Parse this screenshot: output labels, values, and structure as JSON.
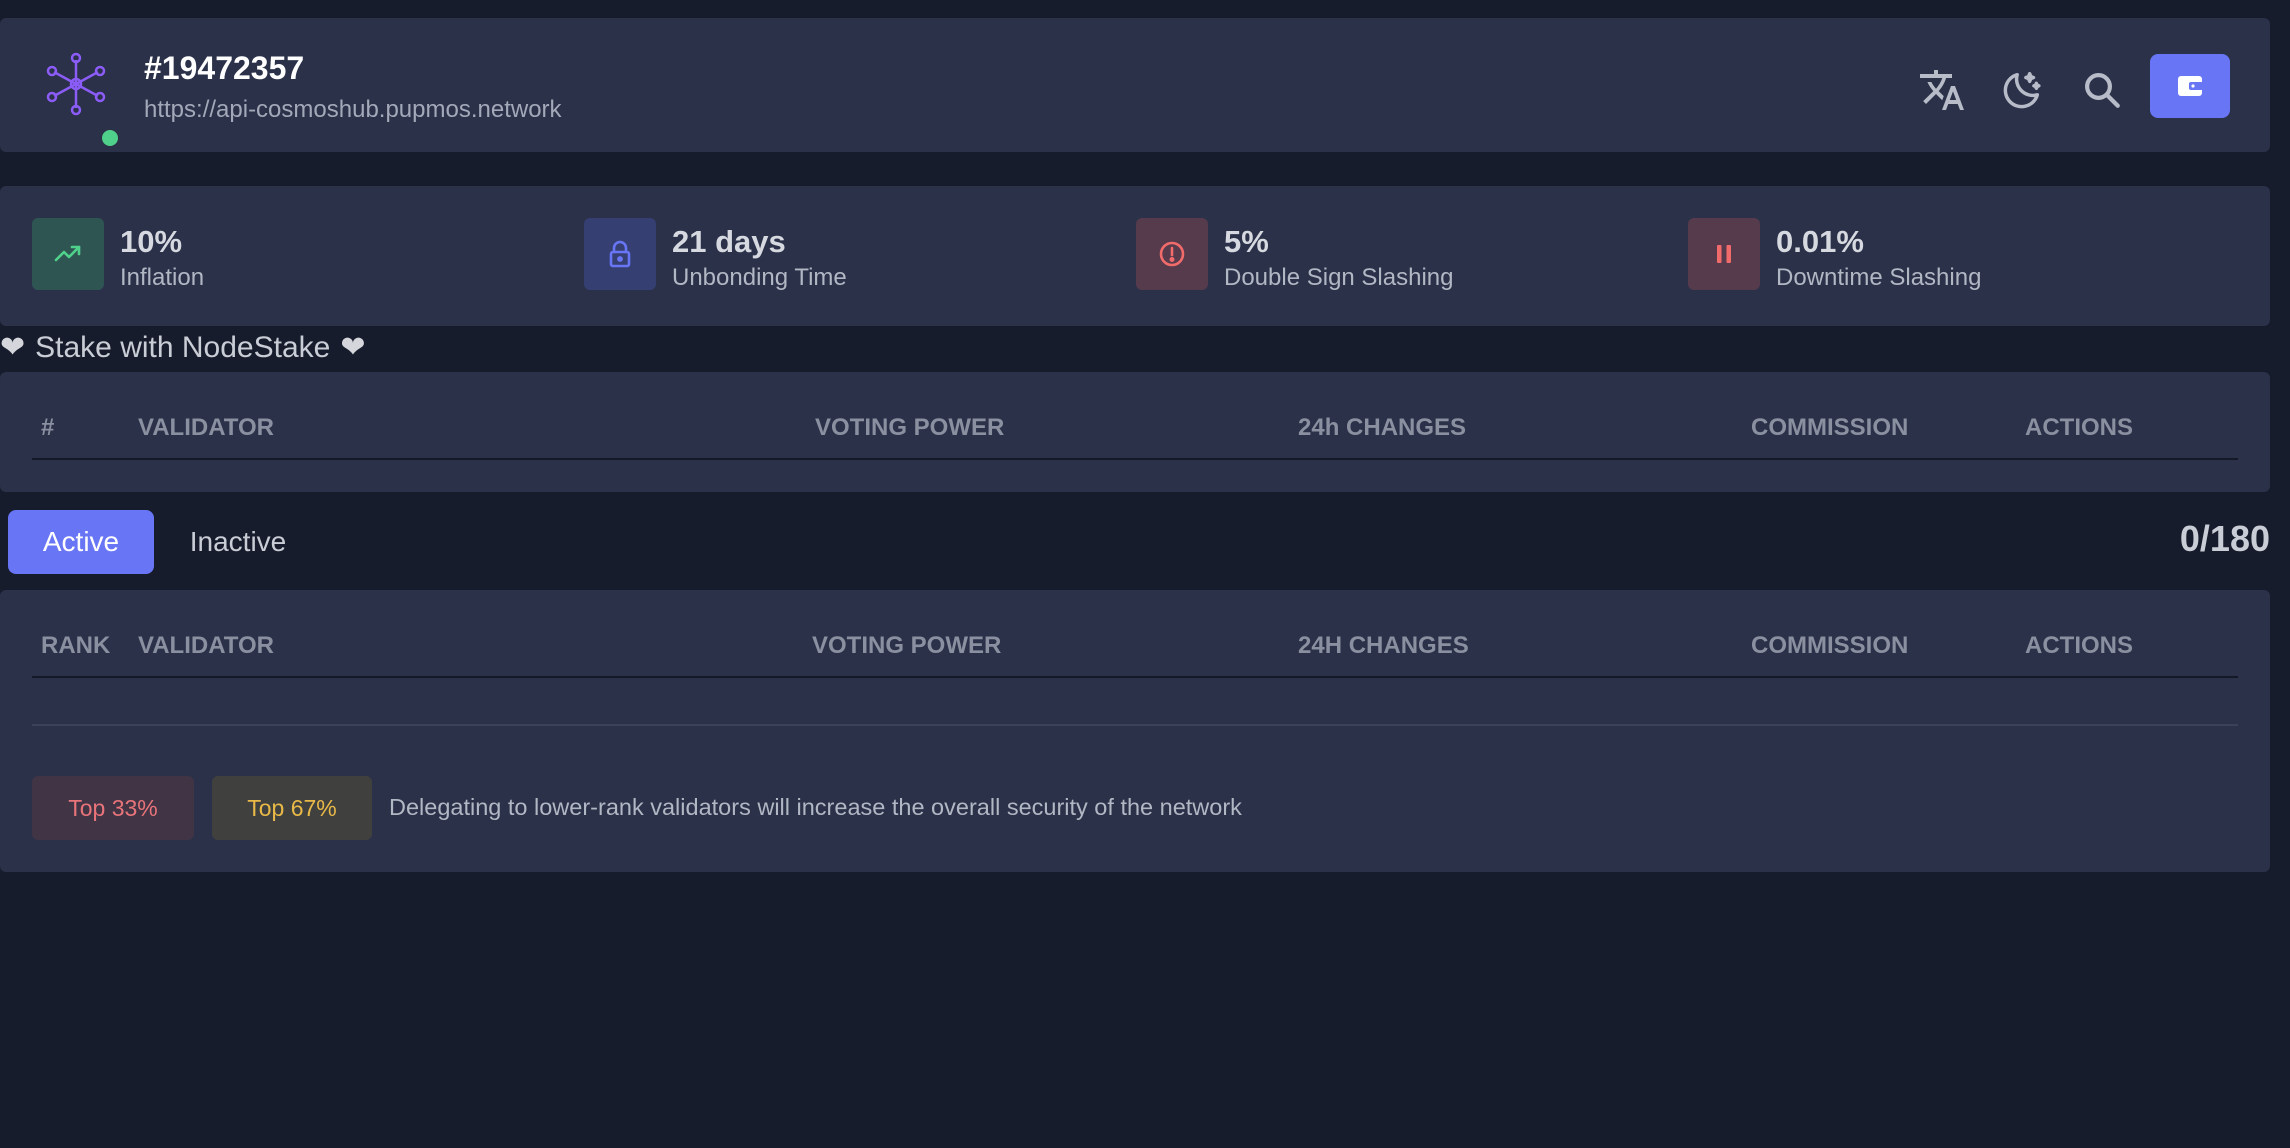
{
  "header": {
    "block_height": "#19472357",
    "endpoint": "https://api-cosmoshub.pupmos.network",
    "icons": [
      "translate-icon",
      "theme-toggle-icon",
      "search-icon",
      "wallet-icon"
    ]
  },
  "stats": [
    {
      "value": "10%",
      "label": "Inflation",
      "icon": "trending-up-icon",
      "color": "#4fd18b"
    },
    {
      "value": "21 days",
      "label": "Unbonding Time",
      "icon": "lock-icon",
      "color": "#6875f5"
    },
    {
      "value": "5%",
      "label": "Double Sign Slashing",
      "icon": "alert-circle-icon",
      "color": "#f26b6b"
    },
    {
      "value": "0.01%",
      "label": "Downtime Slashing",
      "icon": "pause-icon",
      "color": "#f26b6b"
    }
  ],
  "sponsor": {
    "text": "Stake with NodeStake"
  },
  "sponsored_table": {
    "headers": [
      "#",
      "VALIDATOR",
      "VOTING POWER",
      "24h CHANGES",
      "COMMISSION",
      "ACTIONS"
    ]
  },
  "tabs": {
    "active_label": "Active",
    "inactive_label": "Inactive",
    "count": "0/180"
  },
  "main_table": {
    "headers": [
      "RANK",
      "VALIDATOR",
      "VOTING POWER",
      "24H CHANGES",
      "COMMISSION",
      "ACTIONS"
    ]
  },
  "legend": {
    "top33": "Top 33%",
    "top67": "Top 67%",
    "note": "Delegating to lower-rank validators will increase the overall security of the network"
  },
  "colors": {
    "accent": "#6875f5",
    "background": "#171c2c",
    "panel": "#2a3149",
    "online": "#4fd18b"
  }
}
